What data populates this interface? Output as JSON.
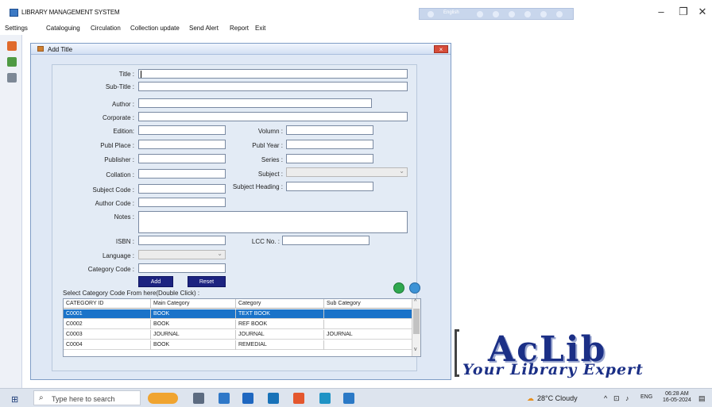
{
  "window": {
    "title": "LIBRARY MANAGEMENT SYSTEM",
    "lang_bar_label": "English",
    "controls": {
      "minimize": "–",
      "restore": "❐",
      "close": "✕"
    }
  },
  "menu": [
    "Settings",
    "Cataloguing",
    "Circulation",
    "Collection update",
    "Send Alert",
    "Report",
    "Exit"
  ],
  "dialog": {
    "title": "Add Title",
    "close_label": "×",
    "labels": {
      "title": "Title :",
      "subtitle": "Sub-Title :",
      "author": "Author :",
      "corporate": "Corporate :",
      "edition": "Edition:",
      "volumn": "Volumn :",
      "publ_place": "Publ Place :",
      "publ_year": "Publ Year :",
      "publisher": "Publisher :",
      "series": "Series :",
      "collation": "Collation :",
      "subject": "Subject :",
      "subject_code": "Subject Code :",
      "subject_heading": "Subject Heading :",
      "author_code": "Author Code :",
      "notes": "Notes :",
      "isbn": "ISBN :",
      "lcc_no": "LCC No. :",
      "language": "Language :",
      "category_code": "Category Code :"
    },
    "buttons": {
      "add": "Add",
      "reset": "Reset"
    },
    "grid_caption": "Select Category Code From here(Double Click) :",
    "grid": {
      "columns": [
        "CATEGORY ID",
        "Main Category",
        "Category",
        "Sub Category"
      ],
      "rows": [
        [
          "C0001",
          "BOOK",
          "TEXT BOOK",
          ""
        ],
        [
          "C0002",
          "BOOK",
          "REF BOOK",
          ""
        ],
        [
          "C0003",
          "JOURNAL",
          "JOURNAL",
          "JOURNAL"
        ],
        [
          "C0004",
          "BOOK",
          "REMEDIAL",
          ""
        ]
      ],
      "selected_row": 0
    }
  },
  "logo": {
    "name": "AcLib",
    "tagline": "Your Library Expert"
  },
  "taskbar": {
    "search_placeholder": "Type here to search",
    "weather": "28°C  Cloudy",
    "lang": "ENG",
    "time": "06:28 AM",
    "date": "16-05-2024"
  },
  "colors": {
    "accent": "#1c2380",
    "selection": "#1a73c9",
    "dialog_bg": "#dfe8f5"
  }
}
